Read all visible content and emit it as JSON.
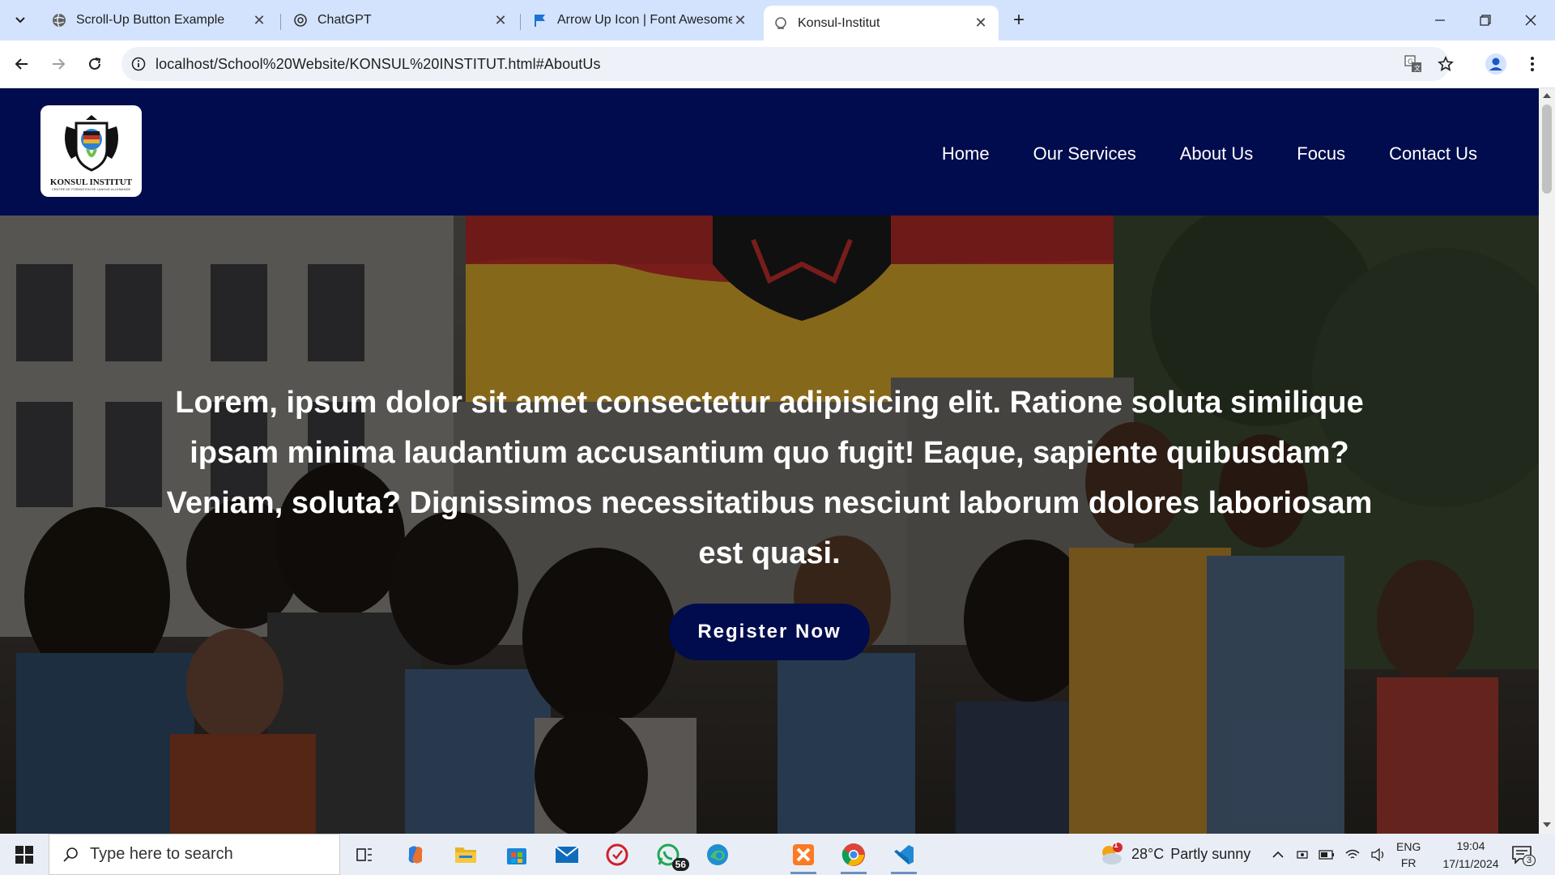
{
  "browser": {
    "tabs": [
      {
        "title": "Scroll-Up Button Example",
        "active": false
      },
      {
        "title": "ChatGPT",
        "active": false
      },
      {
        "title": "Arrow Up Icon | Font Awesome",
        "active": false
      },
      {
        "title": "Konsul-Institut",
        "active": true
      }
    ],
    "url": "localhost/School%20Website/KONSUL%20INSTITUT.html#AboutUs"
  },
  "site": {
    "logo": {
      "brand": "KONSUL INSTITUT",
      "subtitle": "CENTRE DE FORMATION DE LANGUE ALLEMANDE"
    },
    "nav": [
      "Home",
      "Our Services",
      "About Us",
      "Focus",
      "Contact Us"
    ],
    "hero": {
      "text": "Lorem, ipsum dolor sit amet consectetur adipisicing elit. Ratione soluta similique ipsam minima laudantium accusantium quo fugit! Eaque, sapiente quibusdam? Veniam, soluta? Dignissimos necessitatibus nesciunt laborum dolores laboriosam est quasi.",
      "button": "Register Now"
    },
    "colors": {
      "navy": "#000c4d",
      "flag_black": "#1b1b1b",
      "flag_red": "#c2302b",
      "flag_gold": "#e2b22c"
    }
  },
  "taskbar": {
    "search_placeholder": "Type here to search",
    "whatsapp_badge": "56",
    "weather": {
      "temp": "28°C",
      "desc": "Partly sunny",
      "badge": "1"
    },
    "lang": {
      "top": "ENG",
      "bottom": "FR"
    },
    "time": "19:04",
    "date": "17/11/2024",
    "notifications": "3"
  }
}
